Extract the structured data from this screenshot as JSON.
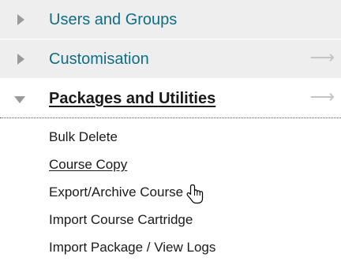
{
  "menu": {
    "sections": [
      {
        "label": "Users and Groups",
        "expanded": false,
        "arrow": ""
      },
      {
        "label": "Customisation",
        "expanded": false,
        "arrow": "⟶"
      },
      {
        "label": "Packages and Utilities",
        "expanded": true,
        "arrow": "⟶"
      }
    ],
    "sub_items": [
      {
        "label": "Bulk Delete"
      },
      {
        "label": "Course Copy",
        "hovered": true
      },
      {
        "label": "Export/Archive Course"
      },
      {
        "label": "Import Course Cartridge"
      },
      {
        "label": "Import Package / View Logs"
      }
    ]
  },
  "cursor": {
    "icon": "hand-pointer-icon"
  },
  "colors": {
    "section_bg": "#eeeeee",
    "section_link": "#0f6d86",
    "active_section": "#1a1a1a",
    "triangle": "#9a9a9a",
    "arrow": "#c4c4c4"
  }
}
